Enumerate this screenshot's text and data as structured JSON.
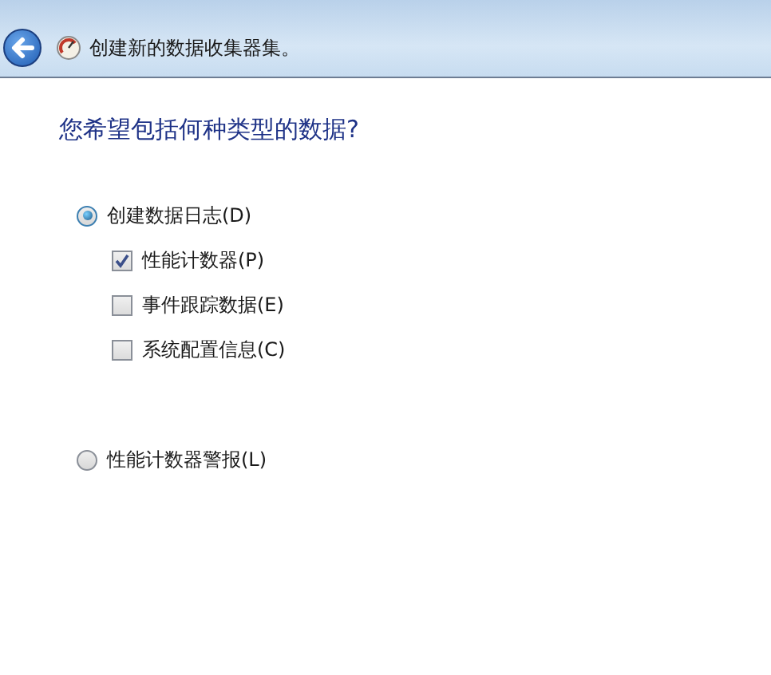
{
  "header": {
    "title": "创建新的数据收集器集。"
  },
  "question": "您希望包括何种类型的数据?",
  "options": [
    {
      "label": "创建数据日志(D)",
      "selected": true,
      "children": [
        {
          "label": "性能计数器(P)",
          "checked": true
        },
        {
          "label": "事件跟踪数据(E)",
          "checked": false
        },
        {
          "label": "系统配置信息(C)",
          "checked": false
        }
      ]
    },
    {
      "label": "性能计数器警报(L)",
      "selected": false
    }
  ]
}
